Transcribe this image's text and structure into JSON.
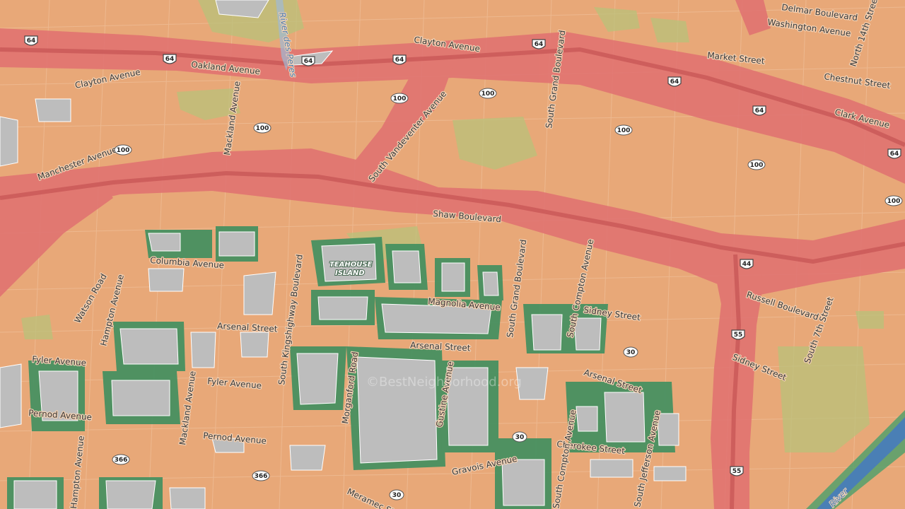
{
  "watermark": "©BestNeighborhood.org",
  "streets": {
    "delmar": "Delmar Boulevard",
    "washington": "Washington Avenue",
    "clayton1": "Clayton Avenue",
    "clayton2": "Clayton Avenue",
    "market": "Market Street",
    "n14th": "North 14th Street",
    "chestnut": "Chestnut Street",
    "clark": "Clark Avenue",
    "oakland": "Oakland Avenue",
    "sgrand1": "South Grand Boulevard",
    "mackland1": "Mackland Avenue",
    "manchester": "Manchester Avenue",
    "svandeventer": "South Vandeventer Avenue",
    "shaw": "Shaw Boulevard",
    "columbia": "Columbia Avenue",
    "watson": "Watson Road",
    "hampton1": "Hampton Avenue",
    "skingshighway": "South Kingshighway Boulevard",
    "arsenal1": "Arsenal Street",
    "arsenal2": "Arsenal Street",
    "arsenal3": "Arsenal Street",
    "magnolia": "Magnolia Avenue",
    "sgrand2": "South Grand Boulevard",
    "scompton1": "South Compton Avenue",
    "sidney1": "Sidney Street",
    "sidney2": "Sidney Street",
    "russell": "Russell Boulevard",
    "s7th": "South 7th Street",
    "fyler1": "Fyler Avenue",
    "fyler2": "Fyler Avenue",
    "pernod1": "Pernod Avenue",
    "pernod2": "Pernod Avenue",
    "mackland2": "Mackland Avenue",
    "morganford": "Morganford Road",
    "gustine": "Gustine Avenue",
    "cherokee": "Cherokee Street",
    "scompton2": "South Compton Avenue",
    "sjefferson": "South Jefferson Avenue",
    "gravois": "Gravois Avenue",
    "hampton2": "Hampton Avenue",
    "meramec": "Meramec Street"
  },
  "rivers": {
    "despere": "River des Peres",
    "miss": "River"
  },
  "island": {
    "line1": "TEAHOUSE",
    "line2": "ISLAND"
  },
  "shields": {
    "i64": "64",
    "r100": "100",
    "i44": "44",
    "i55": "55",
    "r30": "30",
    "r366": "366"
  },
  "colors": {
    "base": "#e8a878",
    "high": "#e07070",
    "green": "#b9c27a",
    "park": "#3f8f5f",
    "gray": "#bdbdbd",
    "water": "#4a7fb5"
  }
}
